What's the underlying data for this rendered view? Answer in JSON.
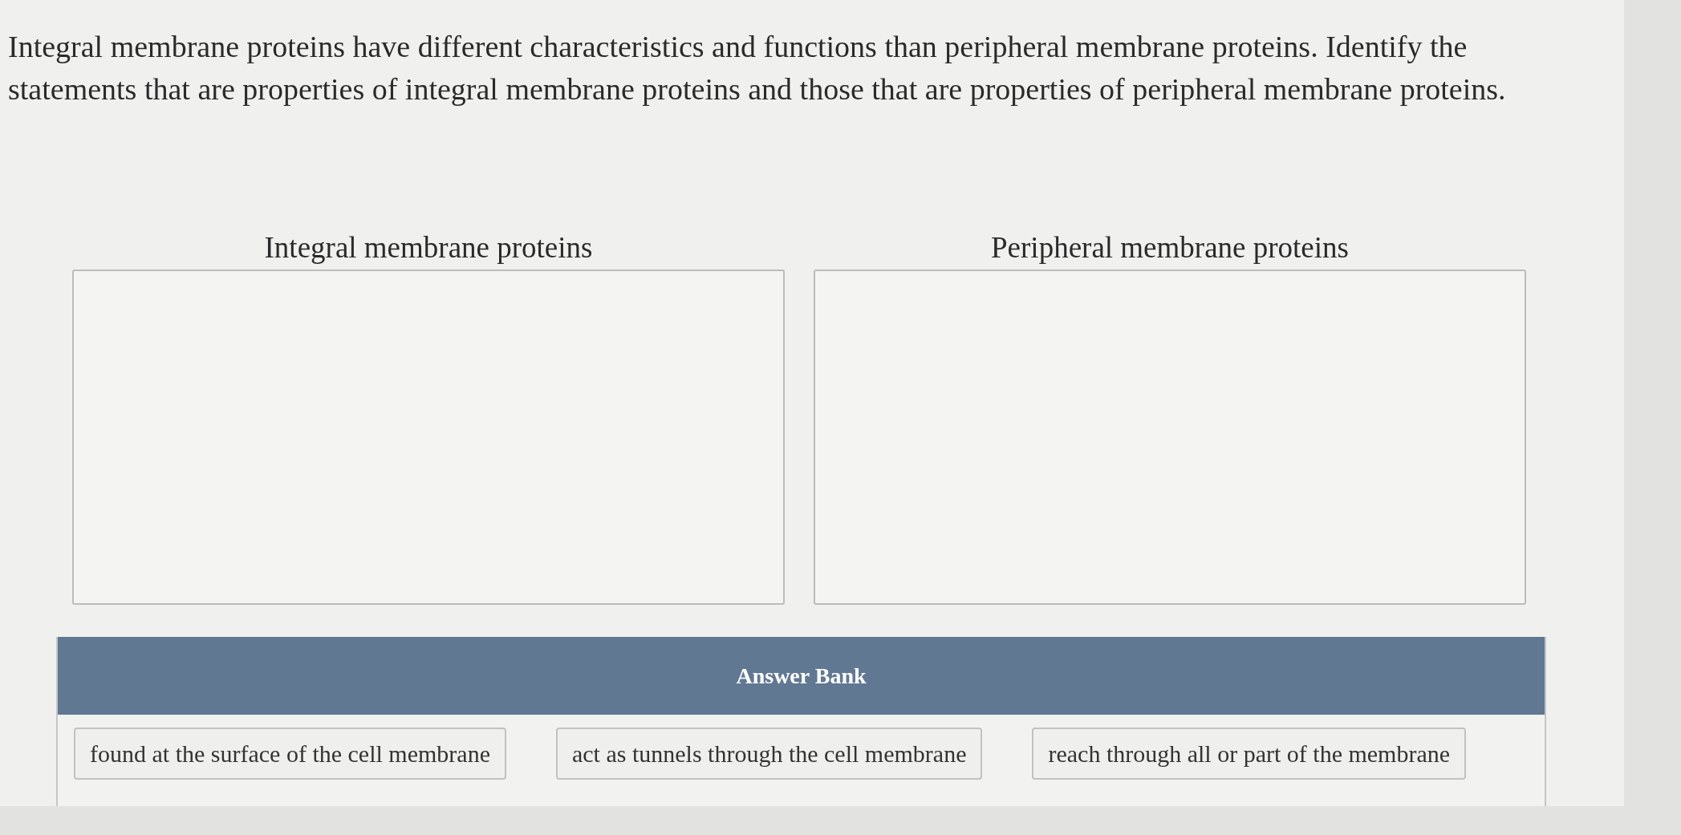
{
  "question": "Integral membrane proteins have different characteristics and functions than peripheral membrane proteins. Identify the statements that are properties of integral membrane proteins and those that are properties of peripheral membrane proteins.",
  "categories": [
    {
      "title": "Integral membrane proteins"
    },
    {
      "title": "Peripheral membrane proteins"
    }
  ],
  "answer_bank": {
    "title": "Answer Bank",
    "items": [
      "found at the surface of the cell membrane",
      "act as tunnels through the cell membrane",
      "reach through all or part of the membrane"
    ]
  }
}
